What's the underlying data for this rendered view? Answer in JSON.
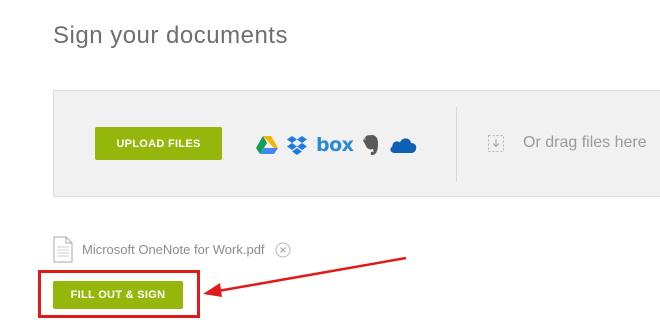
{
  "page": {
    "title": "Sign your documents"
  },
  "upload": {
    "button_label": "UPLOAD FILES",
    "sources": [
      "google-drive-icon",
      "dropbox-icon",
      "box-icon",
      "evernote-icon",
      "onedrive-icon"
    ],
    "box_label": "box",
    "drag_text": "Or drag files here"
  },
  "file": {
    "name": "Microsoft OneNote for Work.pdf"
  },
  "actions": {
    "fill_sign_label": "FILL OUT & SIGN"
  },
  "colors": {
    "accent_green": "#95b70b",
    "annotation_red": "#e01a1a",
    "panel_bg": "#f1f1f1"
  }
}
